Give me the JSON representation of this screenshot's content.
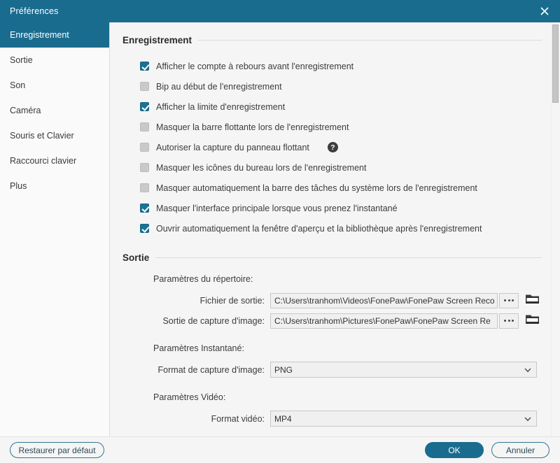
{
  "window": {
    "title": "Préférences",
    "close_icon": "close-icon"
  },
  "sidebar": {
    "items": [
      {
        "label": "Enregistrement",
        "active": true
      },
      {
        "label": "Sortie",
        "active": false
      },
      {
        "label": "Son",
        "active": false
      },
      {
        "label": "Caméra",
        "active": false
      },
      {
        "label": "Souris et Clavier",
        "active": false
      },
      {
        "label": "Raccourci clavier",
        "active": false
      },
      {
        "label": "Plus",
        "active": false
      }
    ]
  },
  "recording": {
    "header": "Enregistrement",
    "options": [
      {
        "label": "Afficher le compte à rebours avant l'enregistrement",
        "checked": true
      },
      {
        "label": "Bip au début de l'enregistrement",
        "checked": false
      },
      {
        "label": "Afficher la limite d'enregistrement",
        "checked": true
      },
      {
        "label": "Masquer la barre flottante lors de l'enregistrement",
        "checked": false
      },
      {
        "label": "Autoriser la capture du panneau flottant",
        "checked": false,
        "help": "?"
      },
      {
        "label": "Masquer les icônes du bureau lors de l'enregistrement",
        "checked": false
      },
      {
        "label": "Masquer automatiquement la barre des tâches du système lors de l'enregistrement",
        "checked": false
      },
      {
        "label": "Masquer l'interface principale lorsque vous prenez l'instantané",
        "checked": true
      },
      {
        "label": "Ouvrir automatiquement la fenêtre d'aperçu et la bibliothèque après l'enregistrement",
        "checked": true
      }
    ]
  },
  "output": {
    "header": "Sortie",
    "directory_settings_label": "Paramètres du répertoire:",
    "output_file": {
      "label": "Fichier de sortie:",
      "value": "C:\\Users\\tranhom\\Videos\\FonePaw\\FonePaw Screen Reco",
      "browse_label": "•••",
      "folder_icon": "folder-icon"
    },
    "image_output": {
      "label": "Sortie de capture d'image:",
      "value": "C:\\Users\\tranhom\\Pictures\\FonePaw\\FonePaw Screen Re",
      "browse_label": "•••",
      "folder_icon": "folder-icon"
    },
    "snapshot_settings_label": "Paramètres Instantané:",
    "image_format": {
      "label": "Format de capture d'image:",
      "value": "PNG"
    },
    "video_settings_label": "Paramètres Vidéo:",
    "video_format": {
      "label": "Format vidéo:",
      "value": "MP4"
    }
  },
  "footer": {
    "restore_label": "Restaurer par défaut",
    "ok_label": "OK",
    "cancel_label": "Annuler"
  },
  "colors": {
    "accent": "#1a6c8f",
    "checkbox_on": "#1a7294",
    "checkbox_off": "#c9c9c9"
  }
}
